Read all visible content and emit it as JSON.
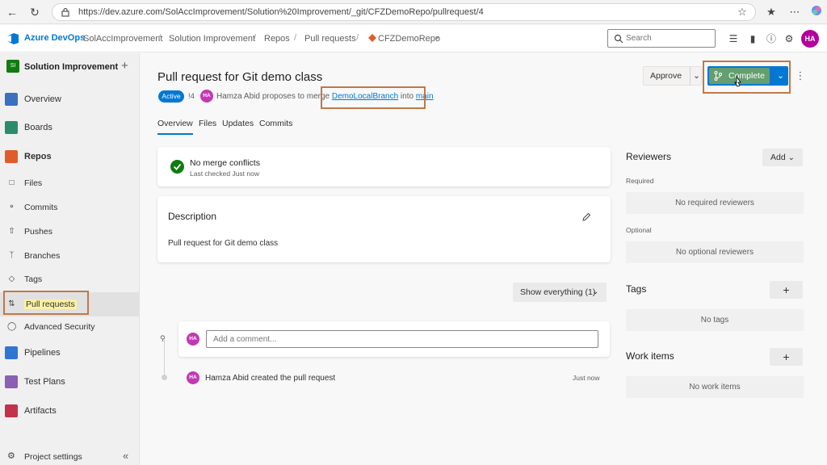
{
  "browser": {
    "url": "https://dev.azure.com/SolAccImprovement/Solution%20Improvement/_git/CFZDemoRepo/pullrequest/4"
  },
  "header": {
    "brand": "Azure DevOps",
    "breadcrumbs": [
      "SolAccImprovement",
      "Solution Improvement",
      "Repos",
      "Pull requests",
      "CFZDemoRepo"
    ],
    "search_placeholder": "Search",
    "avatar_initials": "HA"
  },
  "sidebar": {
    "project_name": "Solution Improvement",
    "project_badge": "SI",
    "items": [
      {
        "label": "Overview",
        "icon": "overview-icon",
        "color": "#3b6fbf"
      },
      {
        "label": "Boards",
        "icon": "boards-icon",
        "color": "#2a8c6d"
      },
      {
        "label": "Repos",
        "icon": "repos-icon",
        "color": "#e05c2a"
      },
      {
        "label": "Pipelines",
        "icon": "pipelines-icon",
        "color": "#2f76d2"
      },
      {
        "label": "Test Plans",
        "icon": "test-plans-icon",
        "color": "#8b5fb3"
      },
      {
        "label": "Artifacts",
        "icon": "artifacts-icon",
        "color": "#c4314b"
      }
    ],
    "repo_subitems": [
      {
        "label": "Files",
        "icon": "file-icon"
      },
      {
        "label": "Commits",
        "icon": "commit-icon"
      },
      {
        "label": "Pushes",
        "icon": "push-icon"
      },
      {
        "label": "Branches",
        "icon": "branch-icon"
      },
      {
        "label": "Tags",
        "icon": "tag-icon"
      },
      {
        "label": "Pull requests",
        "icon": "pull-request-icon"
      },
      {
        "label": "Advanced Security",
        "icon": "shield-icon"
      }
    ],
    "footer_label": "Project settings"
  },
  "pr": {
    "title": "Pull request for Git demo class",
    "status": "Active",
    "number": "!4",
    "author_initials": "HA",
    "author": "Hamza Abid",
    "proposes_text": "proposes to merge",
    "source_branch": "DemoLocalBranch",
    "into_text": "into",
    "target_branch": "main",
    "tabs": [
      "Overview",
      "Files",
      "Updates",
      "Commits"
    ],
    "active_tab": "Overview",
    "approve_label": "Approve",
    "complete_label": "Complete",
    "merge_status": "No merge conflicts",
    "merge_checked": "Last checked Just now",
    "description_title": "Description",
    "description_body": "Pull request for Git demo class",
    "filter_label": "Show everything (1)",
    "comment_placeholder": "Add a comment...",
    "activity_text": "Hamza Abid created the pull request",
    "activity_time": "Just now"
  },
  "right_pane": {
    "reviewers_title": "Reviewers",
    "add_label": "Add",
    "required_label": "Required",
    "no_required": "No required reviewers",
    "optional_label": "Optional",
    "no_optional": "No optional reviewers",
    "tags_title": "Tags",
    "no_tags": "No tags",
    "work_items_title": "Work items",
    "no_work_items": "No work items"
  },
  "colors": {
    "accent": "#0078d4",
    "highlight_border": "#c0784a",
    "avatar": "#c239b3",
    "success": "#107c10"
  }
}
